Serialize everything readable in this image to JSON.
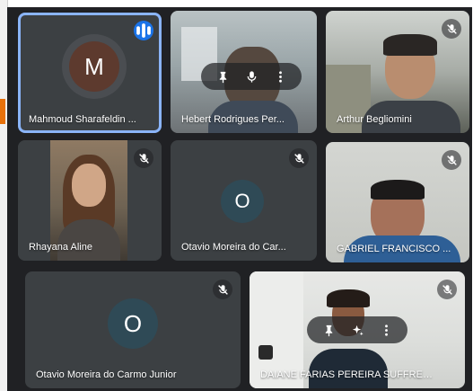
{
  "participants": [
    {
      "name": "Mahmoud Sharafeldin ...",
      "avatar_letter": "M",
      "status": "speaking"
    },
    {
      "name": "Hebert Rodrigues Per..."
    },
    {
      "name": "Arthur Begliomini",
      "status": "muted"
    },
    {
      "name": "Rhayana Aline",
      "status": "muted"
    },
    {
      "name": "Otavio Moreira do Car...",
      "avatar_letter": "O",
      "status": "muted"
    },
    {
      "name": "GABRIEL FRANCISCO ...",
      "status": "muted"
    },
    {
      "name": "Otavio Moreira do Carmo Junior",
      "avatar_letter": "O",
      "status": "muted"
    },
    {
      "name": "DAIANE FARIAS PEREIRA SUFFREDINI",
      "status": "muted"
    }
  ],
  "icons": {
    "mute": "mic-off-icon",
    "speaking": "audio-level-icon",
    "pin": "pin-icon",
    "mic": "mic-icon",
    "more": "more-vert-icon",
    "effects": "sparkle-effects-icon"
  },
  "colors": {
    "background": "#202124",
    "tile": "#3c4043",
    "speaking_border": "#8ab4f8",
    "speaking_badge": "#1a73e8",
    "avatar_m": "#5d3a2e",
    "avatar_o": "#2f4a56"
  }
}
